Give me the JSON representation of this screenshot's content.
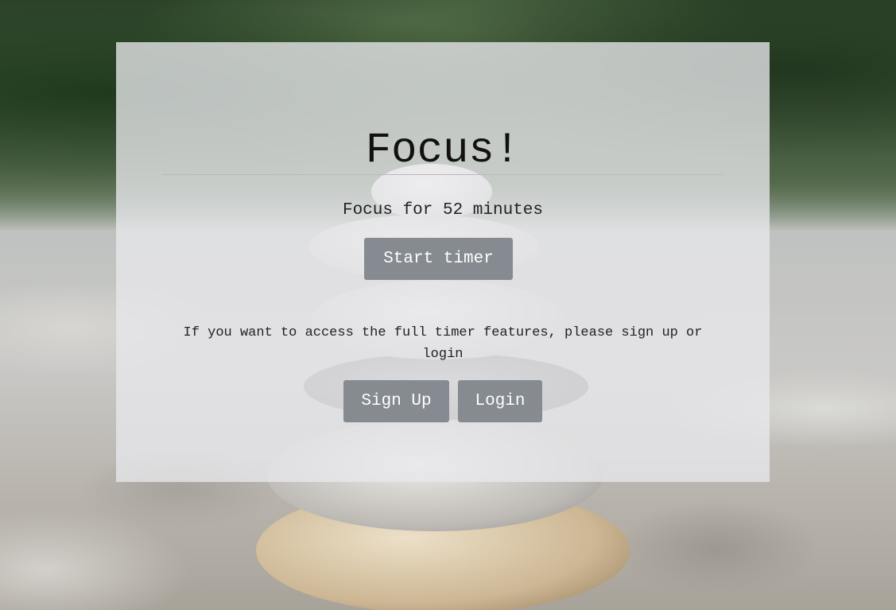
{
  "card": {
    "title": "Focus!",
    "focus_text": "Focus for 52 minutes",
    "start_button_label": "Start timer",
    "notice_text": "If you want to access the full timer features, please sign up or login",
    "signup_button_label": "Sign Up",
    "login_button_label": "Login"
  },
  "colors": {
    "button_bg": "#858b91",
    "card_bg": "rgba(232,232,236,0.78)"
  },
  "background": {
    "image_description_icon": "stacked-stones-background"
  }
}
